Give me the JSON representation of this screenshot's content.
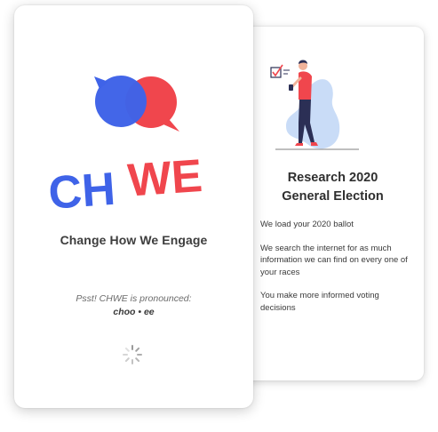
{
  "splash": {
    "logo_word_ch": "CH",
    "logo_word_we": "WE",
    "tagline": "Change How We Engage",
    "pronounce_note": "Psst! CHWE is pronounced:",
    "pronounce_word": "choo • ee"
  },
  "research": {
    "title_line1": "Research 2020",
    "title_line2": "General Election",
    "steps": [
      "We load your 2020 ballot",
      "We search the internet for as much information we can find on every one of your races",
      "You make more informed voting decisions"
    ]
  },
  "colors": {
    "brand_blue": "#3f63e8",
    "brand_red": "#f0464d",
    "illustration_blue": "#c9dcf7"
  },
  "icons": {
    "spinner": "loading-spinner-icon",
    "illustration": "voter-with-phone-illustration"
  }
}
